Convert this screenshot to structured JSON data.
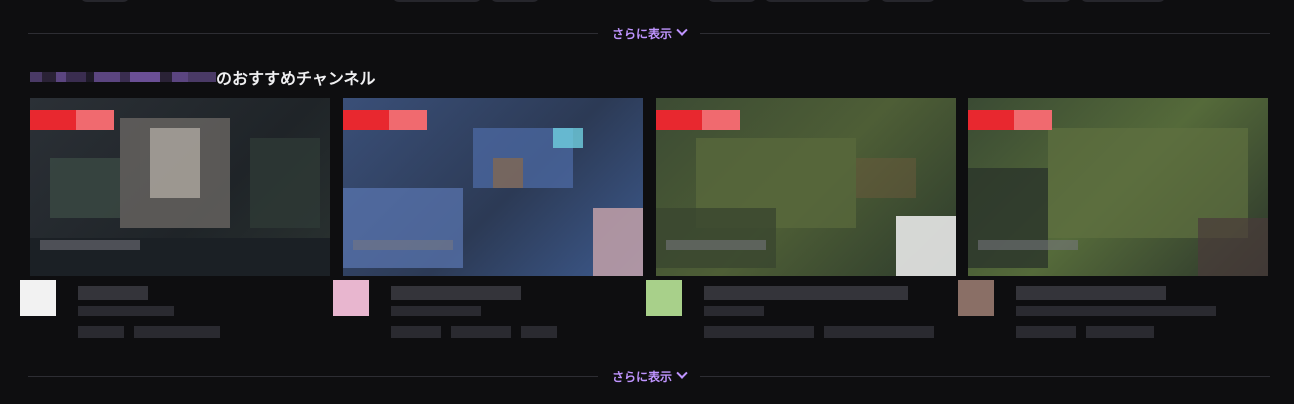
{
  "show_more_top": {
    "label": "さらに表示"
  },
  "show_more_bottom": {
    "label": "さらに表示"
  },
  "recommended": {
    "title": "のおすすめチャンネル",
    "channels": [
      {
        "live": true,
        "avatar_color": "#f2f2f2",
        "thumb_colors": [
          "#2b3036",
          "#4a4d52",
          "#8d8a86",
          "#3b4a44"
        ]
      },
      {
        "live": true,
        "avatar_color": "#e8b6cf",
        "thumb_colors": [
          "#3a4f78",
          "#5b78b4",
          "#2c3a55",
          "#c2a0a8"
        ]
      },
      {
        "live": true,
        "avatar_color": "#a8d08a",
        "thumb_colors": [
          "#3c4b33",
          "#5a6a3c",
          "#2d3b2c",
          "#e8e8e8"
        ]
      },
      {
        "live": true,
        "avatar_color": "#8a6f66",
        "thumb_colors": [
          "#3a4a33",
          "#556a3a",
          "#2b352b",
          "#4a3a3a"
        ]
      }
    ]
  },
  "colors": {
    "accent": "#bf94ff",
    "background": "#0e0e10",
    "live_red": "#e8282f"
  }
}
